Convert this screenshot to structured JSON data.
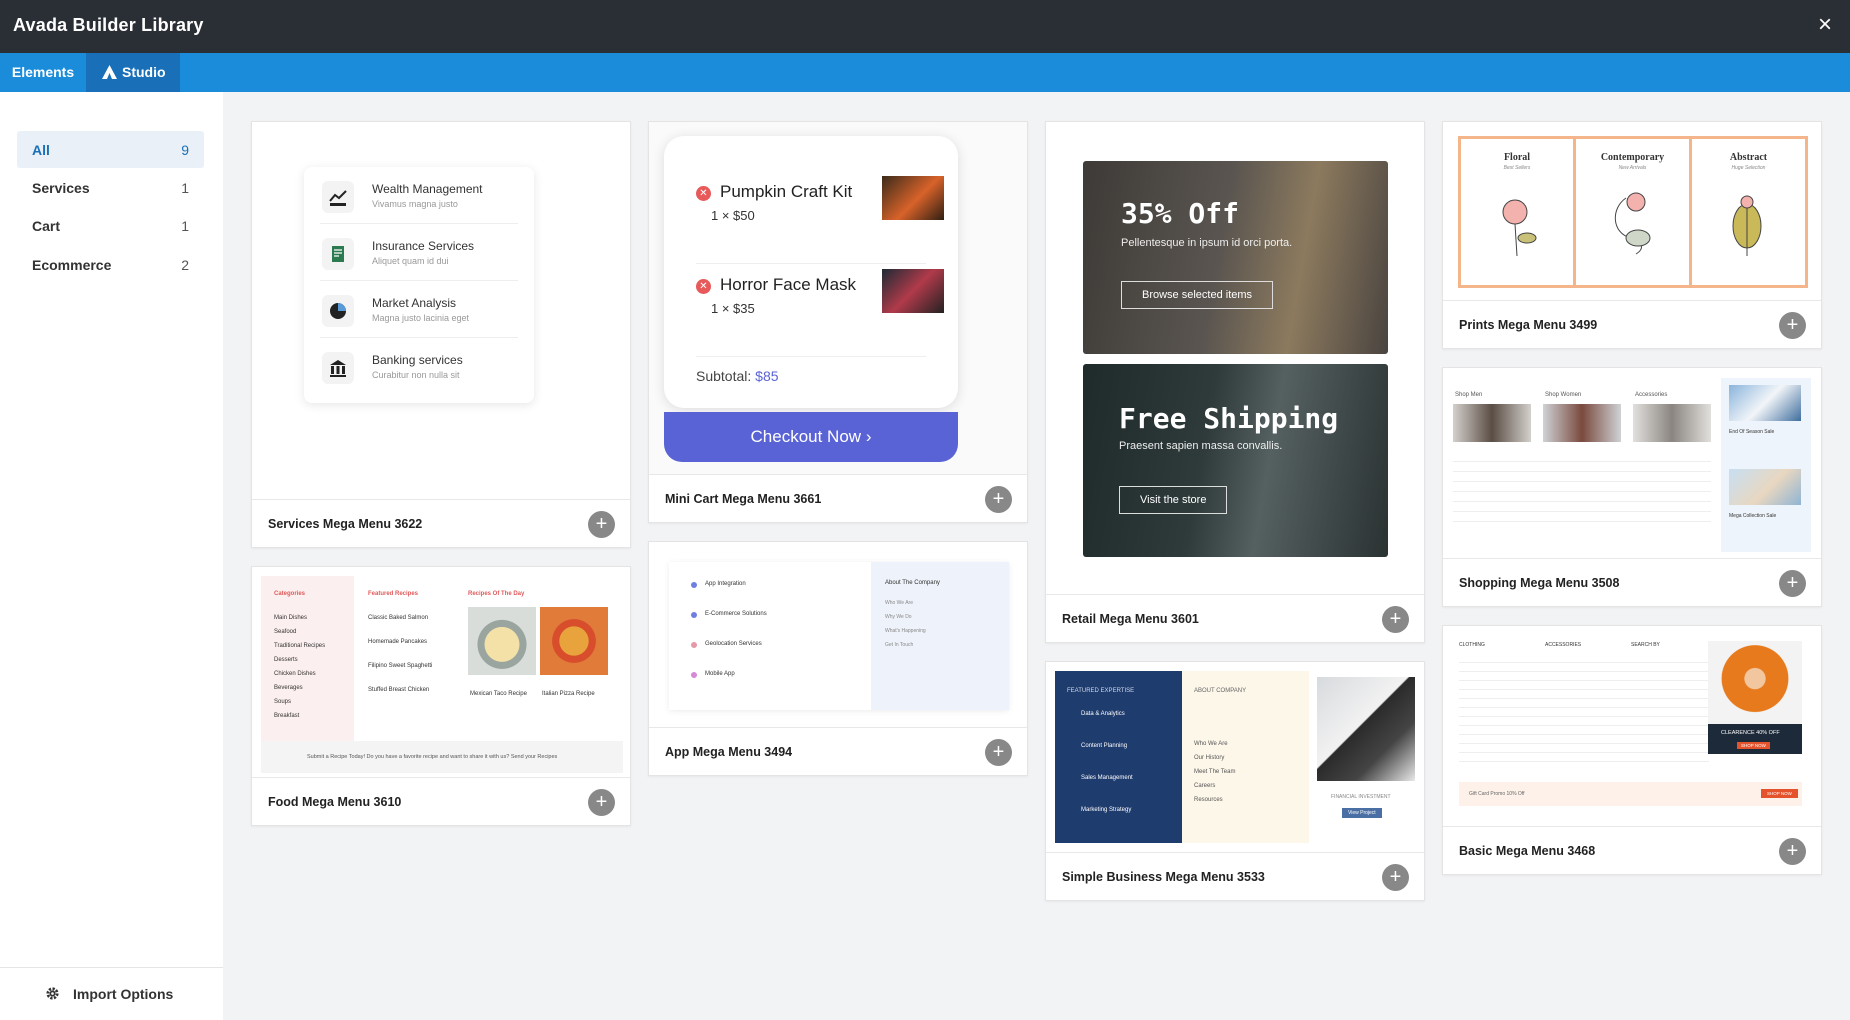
{
  "window": {
    "title": "Avada Builder Library",
    "close_label": "×"
  },
  "tabs": {
    "elements": "Elements",
    "studio": "Studio"
  },
  "sidebar": {
    "items": [
      {
        "label": "All",
        "count": "9"
      },
      {
        "label": "Services",
        "count": "1"
      },
      {
        "label": "Cart",
        "count": "1"
      },
      {
        "label": "Ecommerce",
        "count": "2"
      }
    ],
    "import_label": "Import Options"
  },
  "cards": {
    "services": {
      "name": "Services Mega Menu 3622",
      "rows": [
        {
          "title": "Wealth Management",
          "sub": "Vivamus magna justo"
        },
        {
          "title": "Insurance Services",
          "sub": "Aliquet quam id dui"
        },
        {
          "title": "Market Analysis",
          "sub": "Magna justo lacinia eget"
        },
        {
          "title": "Banking services",
          "sub": "Curabitur non nulla sit"
        }
      ]
    },
    "food": {
      "name": "Food Mega Menu 3610",
      "col1_title": "Categories",
      "col1": [
        "Main Dishes",
        "Seafood",
        "Traditional Recipes",
        "Desserts",
        "Chicken Dishes",
        "Beverages",
        "Soups",
        "Breakfast"
      ],
      "col2_title": "Featured Recipes",
      "col2": [
        "Classic Baked Salmon",
        "Homemade Pancakes",
        "Filipino Sweet Spaghetti",
        "Stuffed Breast Chicken"
      ],
      "col3_title": "Recipes Of The Day",
      "dish1": "Mexican Taco Recipe",
      "dish2": "Italian Pizza Recipe",
      "banner": "Submit a Recipe Today! Do you have a favorite recipe and want to share it with us? Send your Recipes"
    },
    "minicart": {
      "name": "Mini Cart Mega Menu 3661",
      "items": [
        {
          "name": "Pumpkin Craft Kit",
          "qty": "1 × $50"
        },
        {
          "name": "Horror Face Mask",
          "qty": "1 × $35"
        }
      ],
      "subtotal_label": "Subtotal:",
      "subtotal_value": "$85",
      "checkout": "Checkout Now"
    },
    "app": {
      "name": "App Mega Menu 3494",
      "items": [
        "App Integration",
        "E-Commerce Solutions",
        "Geolocation Services",
        "Mobile App"
      ],
      "right_title": "About The Company",
      "right_items": [
        "Who We Are",
        "Why We Do",
        "What's Happening",
        "Get In Touch"
      ]
    },
    "retail": {
      "name": "Retail Mega Menu 3601",
      "panel1": {
        "headline": "35% Off",
        "text": "Pellentesque in ipsum id orci porta.",
        "button": "Browse selected items"
      },
      "panel2": {
        "headline": "Free Shipping",
        "text": "Praesent sapien massa convallis.",
        "button": "Visit the store"
      }
    },
    "business": {
      "name": "Simple Business Mega Menu 3533",
      "col1_title": "FEATURED EXPERTISE",
      "col1": [
        "Data & Analytics",
        "Content Planning",
        "Sales Management",
        "Marketing Strategy"
      ],
      "col2_title": "ABOUT COMPANY",
      "col2": [
        "Who We Are",
        "Our History",
        "Meet The Team",
        "Careers",
        "Resources"
      ],
      "col3_caption": "FINANCIAL INVESTMENT",
      "col3_button": "View Project"
    },
    "prints": {
      "name": "Prints Mega Menu 3499",
      "cols": [
        {
          "title": "Floral",
          "sub": "Best Sellers"
        },
        {
          "title": "Contemporary",
          "sub": "New Arrivals"
        },
        {
          "title": "Abstract",
          "sub": "Huge Selection"
        }
      ]
    },
    "shopping": {
      "name": "Shopping Mega Menu 3508",
      "cols": [
        "Shop Men",
        "Shop Women",
        "Accessories"
      ],
      "promo1": "End Of Season Sale",
      "promo2": "Mega Collection Sale"
    },
    "basic": {
      "name": "Basic Mega Menu 3468",
      "cols": [
        "CLOTHING",
        "ACCESSORIES",
        "SEARCH BY"
      ],
      "promo": "CLEARENCE 40% OFF",
      "promo_btn": "SHOP NOW",
      "bottom": "Gift Card Promo 10% Off",
      "bottom_btn": "SHOP NOW"
    }
  },
  "colors": {
    "titlebar": "#2a2e35",
    "tabbar": "#1b8cd9",
    "studio_tab": "#1a70b8",
    "accent": "#5a63d6"
  }
}
